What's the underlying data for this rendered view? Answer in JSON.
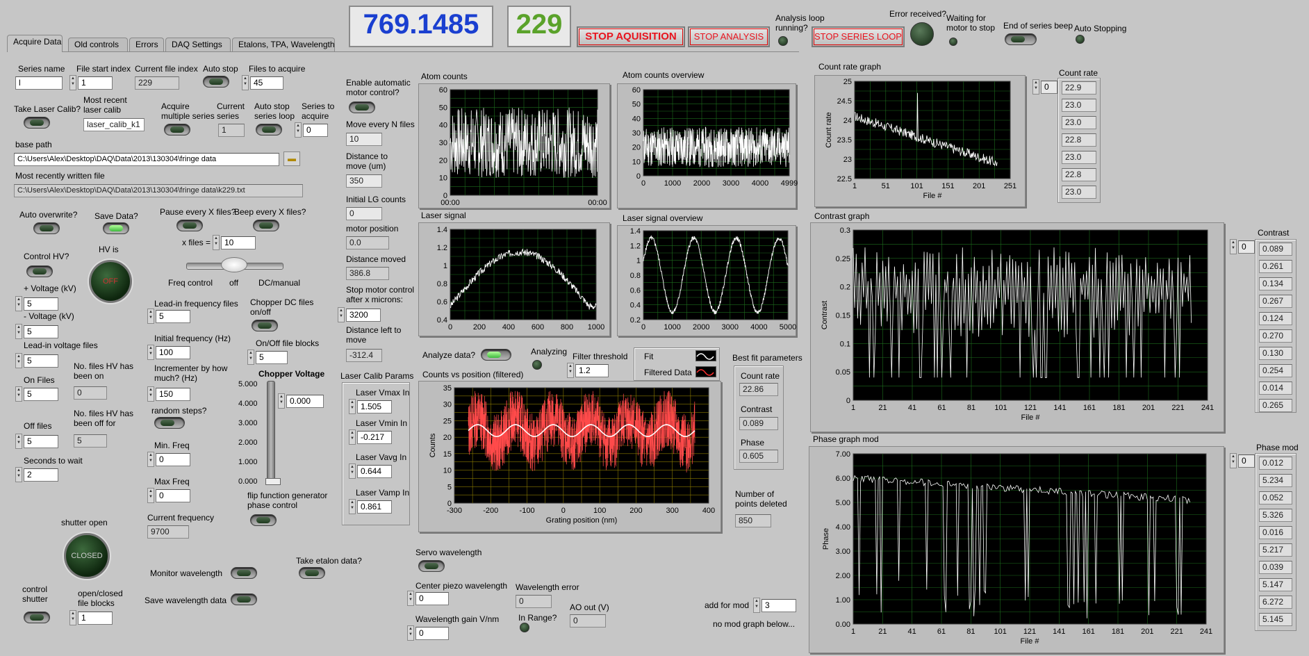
{
  "top": {
    "big_value": "769.1485",
    "count_value": "229",
    "stop_acq": "STOP AQUISITION",
    "stop_analysis": "STOP ANALYSIS",
    "stop_series": "STOP SERIES LOOP",
    "analysis_loop": "Analysis loop running?",
    "error_received": "Error received?",
    "waiting_motor": "Waiting for motor to stop",
    "end_series_beep": "End of series beep",
    "auto_stopping": "Auto Stopping"
  },
  "tabs": [
    "Acquire Data",
    "Old controls",
    "Errors",
    "DAQ Settings",
    "Etalons, TPA, Wavelength"
  ],
  "left": {
    "series_name_label": "Series name",
    "series_name": "l",
    "file_start_label": "File start index",
    "file_start": "1",
    "current_file_label": "Current file index",
    "current_file": "229",
    "auto_stop_label": "Auto stop",
    "files_to_acquire_label": "Files to acquire",
    "files_to_acquire": "45",
    "take_laser_label": "Take Laser Calib?",
    "most_recent_label": "Most recent laser calib",
    "most_recent": "laser_calib_k1",
    "acquire_multiple_label": "Acquire multiple series",
    "current_series_label": "Current series",
    "current_series": "1",
    "auto_stop_loop_label": "Auto stop series loop",
    "series_to_acquire_label": "Series to acquire",
    "series_to_acquire": "0",
    "base_path_label": "base path",
    "base_path": "C:\\Users\\Alex\\Desktop\\DAQ\\Data\\2013\\130304\\fringe data",
    "recent_file_label": "Most recently written file",
    "recent_file": "C:\\Users\\Alex\\Desktop\\DAQ\\Data\\2013\\130304\\fringe data\\k229.txt",
    "auto_overwrite_label": "Auto overwrite?",
    "save_data_label": "Save Data?",
    "pause_label": "Pause every X files?",
    "beep_label": "Beep every X files?",
    "x_files_label": "x files =",
    "x_files": "10",
    "control_hv_label": "Control HV?",
    "hv_is_label": "HV is",
    "hv_state": "OFF",
    "slider_left": "Freq control",
    "slider_mid": "off",
    "slider_right": "DC/manual",
    "plus_v_label": "+ Voltage (kV)",
    "plus_v": "5",
    "minus_v_label": "- Voltage (kV)",
    "minus_v": "5",
    "leadin_v_label": "Lead-in voltage files",
    "leadin_v": "5",
    "on_files_label": "On Files",
    "on_files": "5",
    "hv_on_label": "No. files HV has been on",
    "hv_on": "0",
    "off_files_label": "Off files",
    "off_files": "5",
    "hv_off_label": "No. files HV has been off for",
    "hv_off": "5",
    "seconds_label": "Seconds to wait",
    "seconds": "2",
    "leadin_freq_label": "Lead-in frequency files",
    "leadin_freq": "5",
    "chopper_dc_label": "Chopper DC files on/off",
    "init_freq_label": "Initial frequency (Hz)",
    "init_freq": "100",
    "onoff_blocks_label": "On/Off file blocks",
    "onoff_blocks": "5",
    "increment_label": "Incrementer by how much? (Hz)",
    "increment": "150",
    "chopper_voltage_label": "Chopper Voltage",
    "chopper_voltage": "0.000",
    "chopper_ticks": [
      "5.000",
      "4.000",
      "3.000",
      "2.000",
      "1.000",
      "0.000"
    ],
    "random_label": "random steps?",
    "min_freq_label": "Min. Freq",
    "min_freq": "0",
    "max_freq_label": "Max Freq",
    "max_freq": "0",
    "flip_label": "flip function generator phase control",
    "current_freq_label": "Current frequency",
    "current_freq": "9700",
    "shutter_open_label": "shutter open",
    "shutter_state": "CLOSED",
    "etalon_label": "Take etalon data?",
    "monitor_wl_label": "Monitor wavelength",
    "save_wl_label": "Save wavelength data",
    "control_shutter_label": "control shutter",
    "oc_blocks_label": "open/closed file blocks",
    "oc_blocks": "1"
  },
  "motor": {
    "enable_label": "Enable automatic motor control?",
    "move_every_label": "Move every N files",
    "move_every": "10",
    "distance_label": "Distance to move (um)",
    "distance": "350",
    "initial_lg_label": "Initial LG counts",
    "initial_lg": "0",
    "position_label": "motor position",
    "position": "0.0",
    "moved_label": "Distance moved",
    "moved": "386.8",
    "stop_after_label": "Stop motor control after x microns:",
    "stop_after": "3200",
    "left_label": "Distance left to move",
    "left": "-312.4"
  },
  "laser_calib": {
    "title": "Laser Calib Params",
    "vmax_label": "Laser Vmax In",
    "vmax": "1.505",
    "vmin_label": "Laser Vmin In",
    "vmin": "-0.217",
    "vavg_label": "Laser Vavg In",
    "vavg": "0.644",
    "vamp_label": "Laser Vamp In",
    "vamp": "0.861"
  },
  "analysis": {
    "analyze_label": "Analyze data?",
    "analyzing_label": "Analyzing",
    "filter_label": "Filter threshold",
    "filter": "1.2",
    "fit_label": "Fit",
    "filtered_label": "Filtered Data",
    "bestfit_title": "Best fit parameters",
    "countrate_label": "Count rate",
    "countrate": "22.86",
    "contrast_label": "Contrast",
    "contrast": "0.089",
    "phase_label": "Phase",
    "phase": "0.605",
    "deleted_label": "Number of points deleted",
    "deleted": "850",
    "add_mod_label": "add for mod",
    "add_mod": "3",
    "no_mod": "no mod graph below..."
  },
  "wavelength": {
    "servo_label": "Servo wavelength",
    "center_label": "Center piezo wavelength",
    "center": "0",
    "error_label": "Wavelength error",
    "error": "0",
    "gain_label": "Wavelength gain V/nm",
    "gain": "0",
    "inrange_label": "In Range?",
    "ao_label": "AO out (V)",
    "ao": "0"
  },
  "arrays": {
    "countrate_label": "Count rate",
    "countrate_index": "0",
    "countrate": [
      "22.9",
      "23.0",
      "23.0",
      "22.8",
      "23.0",
      "22.8",
      "23.0"
    ],
    "contrast_label": "Contrast",
    "contrast_index": "0",
    "contrast": [
      "0.089",
      "0.261",
      "0.134",
      "0.267",
      "0.124",
      "0.270",
      "0.130",
      "0.254",
      "0.014",
      "0.265"
    ],
    "phase_label": "Phase mod",
    "phase_index": "0",
    "phase": [
      "0.012",
      "5.234",
      "0.052",
      "5.326",
      "0.016",
      "5.217",
      "0.039",
      "5.147",
      "6.272",
      "5.145"
    ]
  },
  "graphs": {
    "atom": {
      "title": "Atom counts",
      "ylim": [
        0,
        60
      ],
      "yticks": [
        "60",
        "50",
        "40",
        "30",
        "20",
        "10",
        "0"
      ],
      "xticks": [
        "00:00",
        "00:00"
      ]
    },
    "atom_ov": {
      "title": "Atom counts overview",
      "ylim": [
        0,
        60
      ],
      "yticks": [
        "60",
        "50",
        "40",
        "30",
        "20",
        "10",
        "0"
      ],
      "xticks": [
        "0",
        "1000",
        "2000",
        "3000",
        "4000",
        "4999"
      ]
    },
    "laser": {
      "title": "Laser signal",
      "yticks": [
        "1.4",
        "1.2",
        "1",
        "0.8",
        "0.6",
        "0.4"
      ],
      "xticks": [
        "0",
        "200",
        "400",
        "600",
        "800",
        "1000"
      ]
    },
    "laser_ov": {
      "title": "Laser signal overview",
      "yticks": [
        "1.4",
        "1.2",
        "1",
        "0.8",
        "0.6",
        "0.4",
        "0.2"
      ],
      "xticks": [
        "0",
        "1000",
        "2000",
        "3000",
        "4000",
        "5000"
      ]
    },
    "cvp": {
      "title": "Counts vs position (filtered)",
      "ylabel": "Counts",
      "xlabel": "Grating position (nm)",
      "yticks": [
        "35",
        "30",
        "25",
        "20",
        "15",
        "10",
        "5",
        "0"
      ],
      "xticks": [
        "-300",
        "-200",
        "-100",
        "0",
        "100",
        "200",
        "300",
        "400"
      ]
    },
    "crg": {
      "title": "Count rate graph",
      "ylabel": "Count rate",
      "xlabel": "File #",
      "yticks": [
        "25",
        "24.5",
        "24",
        "23.5",
        "23",
        "22.5"
      ],
      "xticks": [
        "1",
        "51",
        "101",
        "151",
        "201",
        "251"
      ]
    },
    "cg": {
      "title": "Contrast graph",
      "ylabel": "Contrast",
      "xlabel": "File #",
      "yticks": [
        "0.3",
        "0.25",
        "0.2",
        "0.15",
        "0.1",
        "0.05",
        "0"
      ],
      "xticks": [
        "1",
        "21",
        "41",
        "61",
        "81",
        "101",
        "121",
        "141",
        "161",
        "181",
        "201",
        "221",
        "241"
      ]
    },
    "pg": {
      "title": "Phase graph mod",
      "ylabel": "Phase",
      "xlabel": "File #",
      "yticks": [
        "7.00",
        "6.00",
        "5.00",
        "4.00",
        "3.00",
        "2.00",
        "1.00",
        "0.00"
      ],
      "xticks": [
        "1",
        "21",
        "41",
        "61",
        "81",
        "101",
        "121",
        "141",
        "161",
        "181",
        "201",
        "221",
        "241"
      ]
    }
  }
}
